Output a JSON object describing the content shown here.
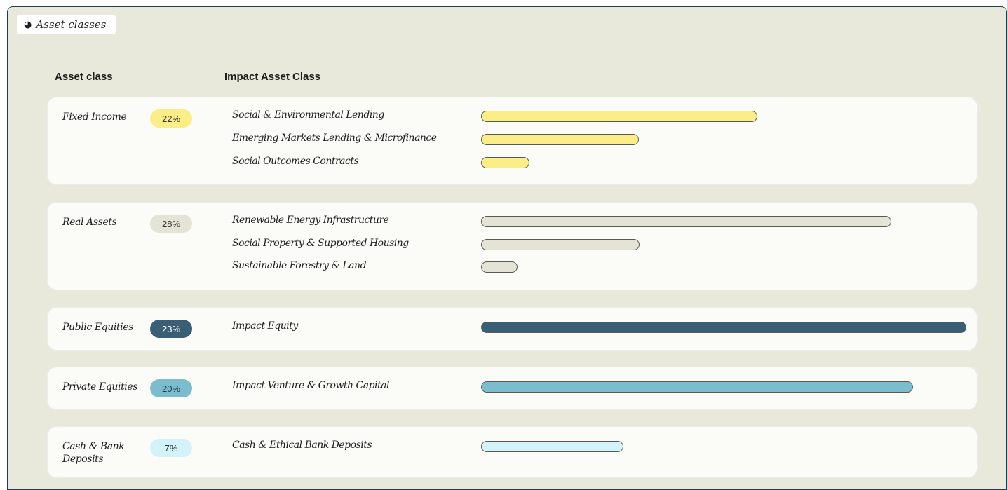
{
  "tag": {
    "icon": "pie-chart-icon",
    "label": "Asset classes"
  },
  "headers": {
    "asset_class": "Asset class",
    "impact_asset_class": "Impact Asset Class"
  },
  "chart_data": {
    "type": "bar",
    "orientation": "horizontal",
    "grid": false,
    "xlim": [
      0,
      1
    ],
    "value_note": "bar lengths relative to the longest bar (Impact Equity); no numeric axis is printed",
    "groups": [
      {
        "name": "Fixed Income",
        "percent": "22%",
        "color": "#fbee86",
        "badge_text_color": "#333333",
        "items": [
          {
            "label": "Social & Environmental Lending",
            "value": 0.57
          },
          {
            "label": "Emerging Markets Lending & Microfinance",
            "value": 0.325
          },
          {
            "label": "Social Outcomes Contracts",
            "value": 0.1
          }
        ]
      },
      {
        "name": "Real Assets",
        "percent": "28%",
        "color": "#e3e3d6",
        "badge_text_color": "#333333",
        "items": [
          {
            "label": "Renewable Energy Infrastructure",
            "value": 0.845
          },
          {
            "label": "Social Property & Supported Housing",
            "value": 0.327
          },
          {
            "label": "Sustainable Forestry & Land",
            "value": 0.075
          }
        ]
      },
      {
        "name": "Public Equities",
        "percent": "23%",
        "color": "#3a5e74",
        "badge_text_color": "#ffffff",
        "items": [
          {
            "label": "Impact Equity",
            "value": 1.0
          }
        ]
      },
      {
        "name": "Private Equities",
        "percent": "20%",
        "color": "#7bbccd",
        "badge_text_color": "#1f3d50",
        "items": [
          {
            "label": "Impact Venture & Growth Capital",
            "value": 0.89
          }
        ]
      },
      {
        "name": "Cash & Bank Deposits",
        "percent": "7%",
        "color": "#d3f3fb",
        "badge_text_color": "#333333",
        "items": [
          {
            "label": "Cash & Ethical Bank Deposits",
            "value": 0.293
          }
        ]
      }
    ]
  }
}
